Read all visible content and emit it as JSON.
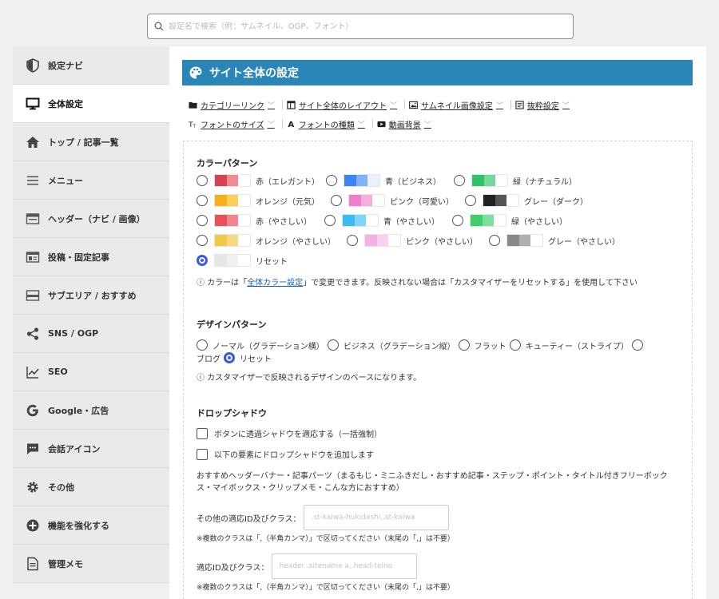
{
  "search": {
    "placeholder": "設定名で検索（例：サムネイル、OGP、フォント）"
  },
  "sidebar": {
    "items": [
      {
        "label": "設定ナビ",
        "icon": "shield-icon"
      },
      {
        "label": "全体設定",
        "icon": "monitor-icon",
        "active": true
      },
      {
        "label": "トップ / 記事一覧",
        "icon": "home-icon"
      },
      {
        "label": "メニュー",
        "icon": "menu-icon"
      },
      {
        "label": "ヘッダー（ナビ / 画像）",
        "icon": "header-icon"
      },
      {
        "label": "投稿・固定記事",
        "icon": "post-icon"
      },
      {
        "label": "サブエリア / おすすめ",
        "icon": "subarea-icon"
      },
      {
        "label": "SNS / OGP",
        "icon": "share-icon"
      },
      {
        "label": "SEO",
        "icon": "chart-icon"
      },
      {
        "label": "Google・広告",
        "icon": "google-icon"
      },
      {
        "label": "会話アイコン",
        "icon": "chat-icon"
      },
      {
        "label": "その他",
        "icon": "gear-icon"
      },
      {
        "label": "機能を強化する",
        "icon": "plus-circle-icon"
      },
      {
        "label": "管理メモ",
        "icon": "memo-icon"
      }
    ]
  },
  "main": {
    "title": "サイト全体の設定",
    "links": [
      {
        "label": "カテゴリーリンク",
        "icon": "folder-icon"
      },
      {
        "label": "サイト全体のレイアウト",
        "icon": "layout-icon"
      },
      {
        "label": "サムネイル画像設定",
        "icon": "image-icon"
      },
      {
        "label": "抜粋設定",
        "icon": "excerpt-icon"
      },
      {
        "label": "フォントのサイズ",
        "icon": "font-size-icon"
      },
      {
        "label": "フォントの種類",
        "icon": "font-type-icon"
      },
      {
        "label": "動画背景",
        "icon": "video-icon"
      }
    ],
    "color_pattern": {
      "title": "カラーパターン",
      "options": [
        {
          "label": "赤（エレガント）",
          "colors": [
            "#d84150",
            "#f18a93",
            "#ffffff"
          ]
        },
        {
          "label": "青（ビジネス）",
          "colors": [
            "#3a84f3",
            "#7fb3f8",
            "#e8f2ff"
          ]
        },
        {
          "label": "緑（ナチュラル）",
          "colors": [
            "#2fc267",
            "#72d99a",
            "#ffffff"
          ]
        },
        {
          "label": "オレンジ（元気）",
          "colors": [
            "#f5b01a",
            "#f9cf5c",
            "#ffffff"
          ]
        },
        {
          "label": "ピンク（可愛い）",
          "colors": [
            "#f07fcb",
            "#f5aedd",
            "#ffffff"
          ]
        },
        {
          "label": "グレー（ダーク）",
          "colors": [
            "#222222",
            "#555555",
            "#ffffff"
          ]
        },
        {
          "label": "赤（やさしい）",
          "colors": [
            "#e9505a",
            "#f0878f",
            "#ffffff"
          ]
        },
        {
          "label": "青（やさしい）",
          "colors": [
            "#38bdf0",
            "#7dd6f6",
            "#ffffff"
          ]
        },
        {
          "label": "緑（やさしい）",
          "colors": [
            "#3ecf69",
            "#7de09a",
            "#ffffff"
          ]
        },
        {
          "label": "オレンジ（やさしい）",
          "colors": [
            "#f3c84a",
            "#f7da80",
            "#ffffff"
          ]
        },
        {
          "label": "ピンク（やさしい）",
          "colors": [
            "#f7b0e4",
            "#fad0ee",
            "#ffffff"
          ]
        },
        {
          "label": "グレー（やさしい）",
          "colors": [
            "#8a8a8a",
            "#b0b0b0",
            "#ffffff"
          ]
        },
        {
          "label": "リセット",
          "colors": [
            "#e6e6e6",
            "#f0f0f0",
            "#ffffff"
          ],
          "selected": true
        }
      ],
      "note_pre": "ⓘ カラーは「",
      "note_link": "全体カラー設定",
      "note_post": "」で変更できます。反映されない場合は「カスタマイザーをリセットする」を使用して下さい"
    },
    "design_pattern": {
      "title": "デザインパターン",
      "options": [
        {
          "label": "ノーマル（グラデーション横）"
        },
        {
          "label": "ビジネス（グラデーション縦）"
        },
        {
          "label": "フラット"
        },
        {
          "label": "キューティー（ストライプ）"
        },
        {
          "label": "ブログ"
        },
        {
          "label": "リセット",
          "selected": true
        }
      ],
      "note": "ⓘ カスタマイザーで反映されるデザインのベースになります。"
    },
    "drop_shadow": {
      "title": "ドロップシャドウ",
      "check1": "ボタンに透過シャドウを適応する（一括強制）",
      "check2": "以下の要素にドロップシャドウを追加します",
      "desc": "おすすめヘッダーバナー・記事パーツ（まるもじ・ミニふきだし・おすすめ記事・ステップ・ポイント・タイトル付きフリーボックス・マイボックス・クリップメモ・こんな方におすすめ）",
      "field1_label": "その他の適応ID及びクラス：",
      "field1_placeholder": ".st-kaiwa-hukidashi,.st-kaiwa",
      "field1_note": "※複数のクラスは「,（半角カンマ）」で区切ってください（末尾の「,」は不要）",
      "field2_label": "適応ID及びクラス：",
      "field2_placeholder": "header .sitename a,.head-telno",
      "field2_note": "※複数のクラスは「,（半角カンマ）」で区切ってください（末尾の「,」は不要）"
    }
  }
}
